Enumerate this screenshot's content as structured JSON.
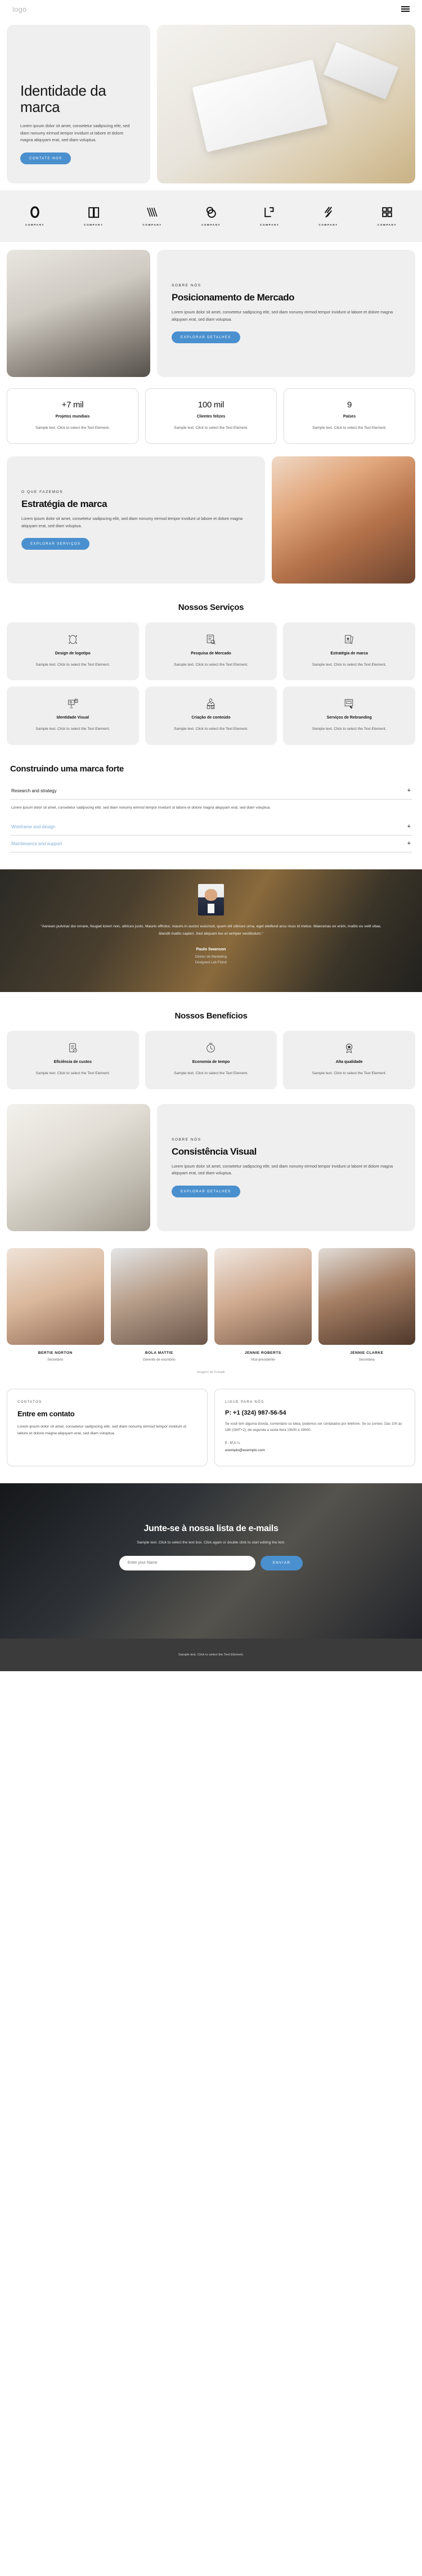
{
  "header": {
    "logo": "logo",
    "menu_icon": "hamburger-menu-icon"
  },
  "hero": {
    "title": "Identidade da marca",
    "text": "Lorem ipsum dolor sit amet, consetetur sadipscing elitr, sed diam nonumy eirmod tempor invidunt ut labore et dolore magna aliquyam erat, sed diam voluptua.",
    "cta": "CONTATE-NOS"
  },
  "clients": [
    {
      "name": "COMPANY"
    },
    {
      "name": "COMPANY"
    },
    {
      "name": "COMPANY"
    },
    {
      "name": "COMPANY"
    },
    {
      "name": "COMPANY"
    },
    {
      "name": "COMPANY"
    },
    {
      "name": "COMPANY"
    }
  ],
  "about": {
    "eyebrow": "SOBRE NÓS",
    "title": "Posicionamento de Mercado",
    "text": "Lorem ipsum dolor sit amet, consetetur sadipscing elitr, sed diam nonumy eirmod tempor invidunt ut labore et dolore magna aliquyam erat, sed diam voluptua.",
    "cta": "EXPLORAR DETALHES"
  },
  "stats": [
    {
      "num": "+7 mil",
      "label": "Projetos mundiais",
      "text": "Sample text. Click to select the Text Element."
    },
    {
      "num": "100 mil",
      "label": "Clientes felizes",
      "text": "Sample text. Click to select the Text Element."
    },
    {
      "num": "9",
      "label": "Países",
      "text": "Sample text. Click to select the Text Element."
    }
  ],
  "strategy": {
    "eyebrow": "O QUE FAZEMOS",
    "title": "Estratégia de marca",
    "text": "Lorem ipsum dolor sit amet, consetetur sadipscing elitr, sed diam nonumy eirmod tempor invidunt ut labore et dolore magna aliquyam erat, sed diam voluptua.",
    "cta": "EXPLORAR SERVIÇOS"
  },
  "services": {
    "heading": "Nossos Serviços",
    "items": [
      {
        "title": "Design de logotipo",
        "text": "Sample text. Click to select the Text Element.",
        "icon": "logo-design-icon"
      },
      {
        "title": "Pesquisa de Mercado",
        "text": "Sample text. Click to select the Text Element.",
        "icon": "market-research-icon"
      },
      {
        "title": "Estratégia de marca",
        "text": "Sample text. Click to select the Text Element.",
        "icon": "brand-strategy-icon"
      },
      {
        "title": "Identidade Visual",
        "text": "Sample text. Click to select the Text Element.",
        "icon": "visual-identity-icon"
      },
      {
        "title": "Criação de conteúdo",
        "text": "Sample text. Click to select the Text Element.",
        "icon": "content-creation-icon"
      },
      {
        "title": "Serviços de Rebranding",
        "text": "Sample text. Click to select the Text Element.",
        "icon": "rebranding-icon"
      }
    ]
  },
  "accordion": {
    "heading": "Construindo uma marca forte",
    "items": [
      {
        "label": "Research and strategy",
        "open": true,
        "body": "Lorem ipsum dolor sit amet, consetetur sadipscing elitr, sed diam nonumy eirmod tempor invidunt ut labore et dolore magna aliquyam erat, sed diam voluptua.",
        "toggle": "+"
      },
      {
        "label": "Wireframe and design",
        "open": false,
        "body": "",
        "toggle": "+"
      },
      {
        "label": "Maintenance and support",
        "open": false,
        "body": "",
        "toggle": "+"
      }
    ]
  },
  "testimonial": {
    "quote": "\"Aenean pulvinar dui ornare, feugiat lorem non, ultrices justo. Mauris efficitur, mauris in auctor euismod, quam elit ultrices urna, eget eleifend arcu risus id metus. Maecenas ex enim, mattis eu velit vitae, blandit mattis sapien. Sed aliquam leo et semper vestibulum.\"",
    "name": "Paulo Swanson",
    "role": "Diretor de Marketing",
    "company": "Designed Lab Finish"
  },
  "benefits": {
    "heading": "Nossos Benefícios",
    "items": [
      {
        "title": "Eficiência de custos",
        "text": "Sample text. Click to select the Text Element.",
        "icon": "cost-efficiency-icon"
      },
      {
        "title": "Economia de tempo",
        "text": "Sample text. Click to select the Text Element.",
        "icon": "time-saving-icon"
      },
      {
        "title": "Alta qualidade",
        "text": "Sample text. Click to select the Text Element.",
        "icon": "high-quality-icon"
      }
    ]
  },
  "consistency": {
    "eyebrow": "SOBRE NÓS",
    "title": "Consistência Visual",
    "text": "Lorem ipsum dolor sit amet, consetetur sadipscing elitr, sed diam nonumy eirmod tempor invidunt ut labore et dolore magna aliquyam erat, sed diam voluptua.",
    "cta": "EXPLORAR DETALHES"
  },
  "team": {
    "members": [
      {
        "name": "BERTIE NORTON",
        "role": "Secretário"
      },
      {
        "name": "BOLA MATTIE",
        "role": "Gerente de escritório"
      },
      {
        "name": "JENNIE ROBERTS",
        "role": "Vice-presidente"
      },
      {
        "name": "JENNIE CLARKE",
        "role": "Secretária"
      }
    ],
    "credit": "Imagem de Freepik"
  },
  "contact": {
    "eyebrow": "CONTATOS",
    "title": "Entre em contato",
    "text": "Lorem ipsum dolor sit amet, consetetur sadipscing elitr, sed diam nonumy eirmod tempor invidunt ut labore et dolore magna aliquyam erat, sed diam voluptua.",
    "call_label": "LIGUE PARA NÓS",
    "phone": "P: +1 (324) 987-56-54",
    "sub": "Se você tem alguma dúvida, comentário ou ideia, podemos ser contatados por telefone. Se ou correio. Das 10h às 18h (GMT+2), de segunda a sexta-feira 10h00 à 19h00.",
    "email_label": "E-MAIL",
    "email": "exemplo@exemplo.com"
  },
  "newsletter": {
    "title": "Junte-se à nossa lista de e-mails",
    "text": "Sample text. Click to select the text box. Click again or double click to start editing the text.",
    "placeholder": "Enter your Name",
    "cta": "ENVIAR"
  },
  "footer": {
    "text": "Sample text. Click to select the Text Element."
  }
}
